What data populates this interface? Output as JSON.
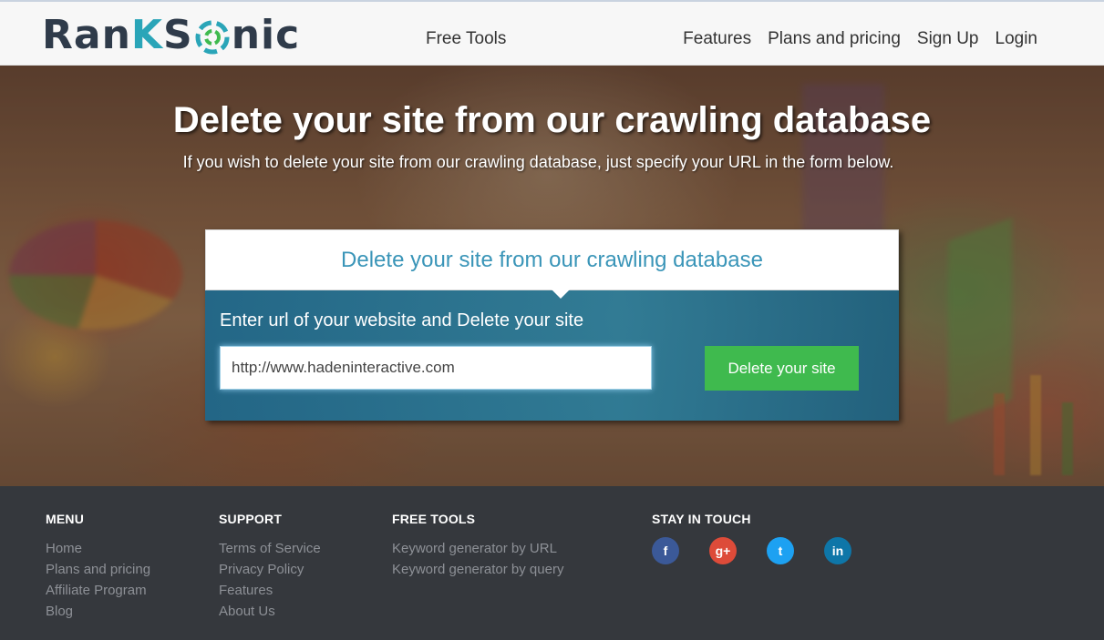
{
  "header": {
    "logo": {
      "part1": "Ran",
      "part2": "K",
      "part3": "S",
      "part4": "nic"
    },
    "nav_free_tools": "Free Tools",
    "nav_right": [
      "Features",
      "Plans and pricing",
      "Sign Up",
      "Login"
    ]
  },
  "hero": {
    "title": "Delete your site from our crawling database",
    "subtitle": "If you wish to delete your site from our crawling database, just specify your URL in the form below."
  },
  "form": {
    "heading": "Delete your site from our crawling database",
    "label": "Enter url of your website and Delete your site",
    "url_value": "http://www.hadeninteractive.com",
    "button": "Delete your site"
  },
  "footer": {
    "menu": {
      "title": "MENU",
      "items": [
        "Home",
        "Plans and pricing",
        "Affiliate Program",
        "Blog"
      ]
    },
    "support": {
      "title": "SUPPORT",
      "items": [
        "Terms of Service",
        "Privacy Policy",
        "Features",
        "About Us"
      ]
    },
    "free_tools": {
      "title": "FREE TOOLS",
      "items": [
        "Keyword generator by URL",
        "Keyword generator by query"
      ]
    },
    "stay_in_touch": {
      "title": "STAY IN TOUCH",
      "icons": [
        {
          "name": "facebook-icon",
          "glyph": "f",
          "color": "#3b5998"
        },
        {
          "name": "google-plus-icon",
          "glyph": "g+",
          "color": "#dd4b39"
        },
        {
          "name": "twitter-icon",
          "glyph": "t",
          "color": "#1da1f2"
        },
        {
          "name": "linkedin-icon",
          "glyph": "in",
          "color": "#0e76a8"
        }
      ]
    }
  },
  "colors": {
    "accent": "#3a95b8",
    "button_green": "#3fba4e",
    "footer_bg": "#35383d"
  }
}
